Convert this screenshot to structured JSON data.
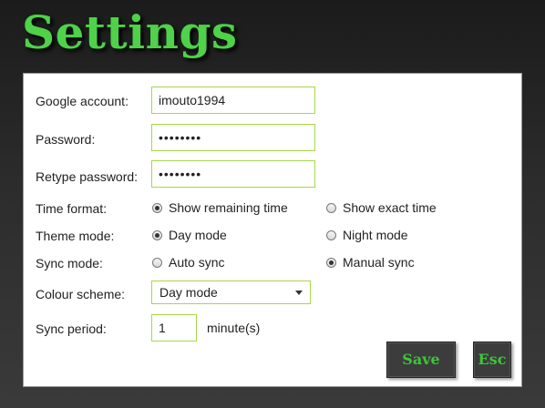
{
  "window": {
    "title": "Settings"
  },
  "account": {
    "label": "Google account:",
    "value": "imouto1994"
  },
  "password": {
    "label": "Password:",
    "masked_value": "••••••••"
  },
  "retype_password": {
    "label": "Retype password:",
    "masked_value": "••••••••"
  },
  "time_format": {
    "label": "Time format:",
    "options": [
      {
        "label": "Show remaining time",
        "checked": true
      },
      {
        "label": "Show exact time",
        "checked": false
      }
    ]
  },
  "theme_mode": {
    "label": "Theme mode:",
    "options": [
      {
        "label": "Day mode",
        "checked": true
      },
      {
        "label": "Night mode",
        "checked": false
      }
    ]
  },
  "sync_mode": {
    "label": "Sync mode:",
    "options": [
      {
        "label": "Auto sync",
        "checked": false
      },
      {
        "label": "Manual sync",
        "checked": true
      }
    ]
  },
  "colour_scheme": {
    "label": "Colour scheme:",
    "selected": "Day mode"
  },
  "sync_period": {
    "label": "Sync period:",
    "value": "1",
    "unit": "minute(s)"
  },
  "buttons": {
    "save": "Save",
    "esc": "Esc"
  },
  "colors": {
    "accent_green": "#4fd14a",
    "field_border": "#a6d84a",
    "button_bg": "#3c3c3c"
  }
}
